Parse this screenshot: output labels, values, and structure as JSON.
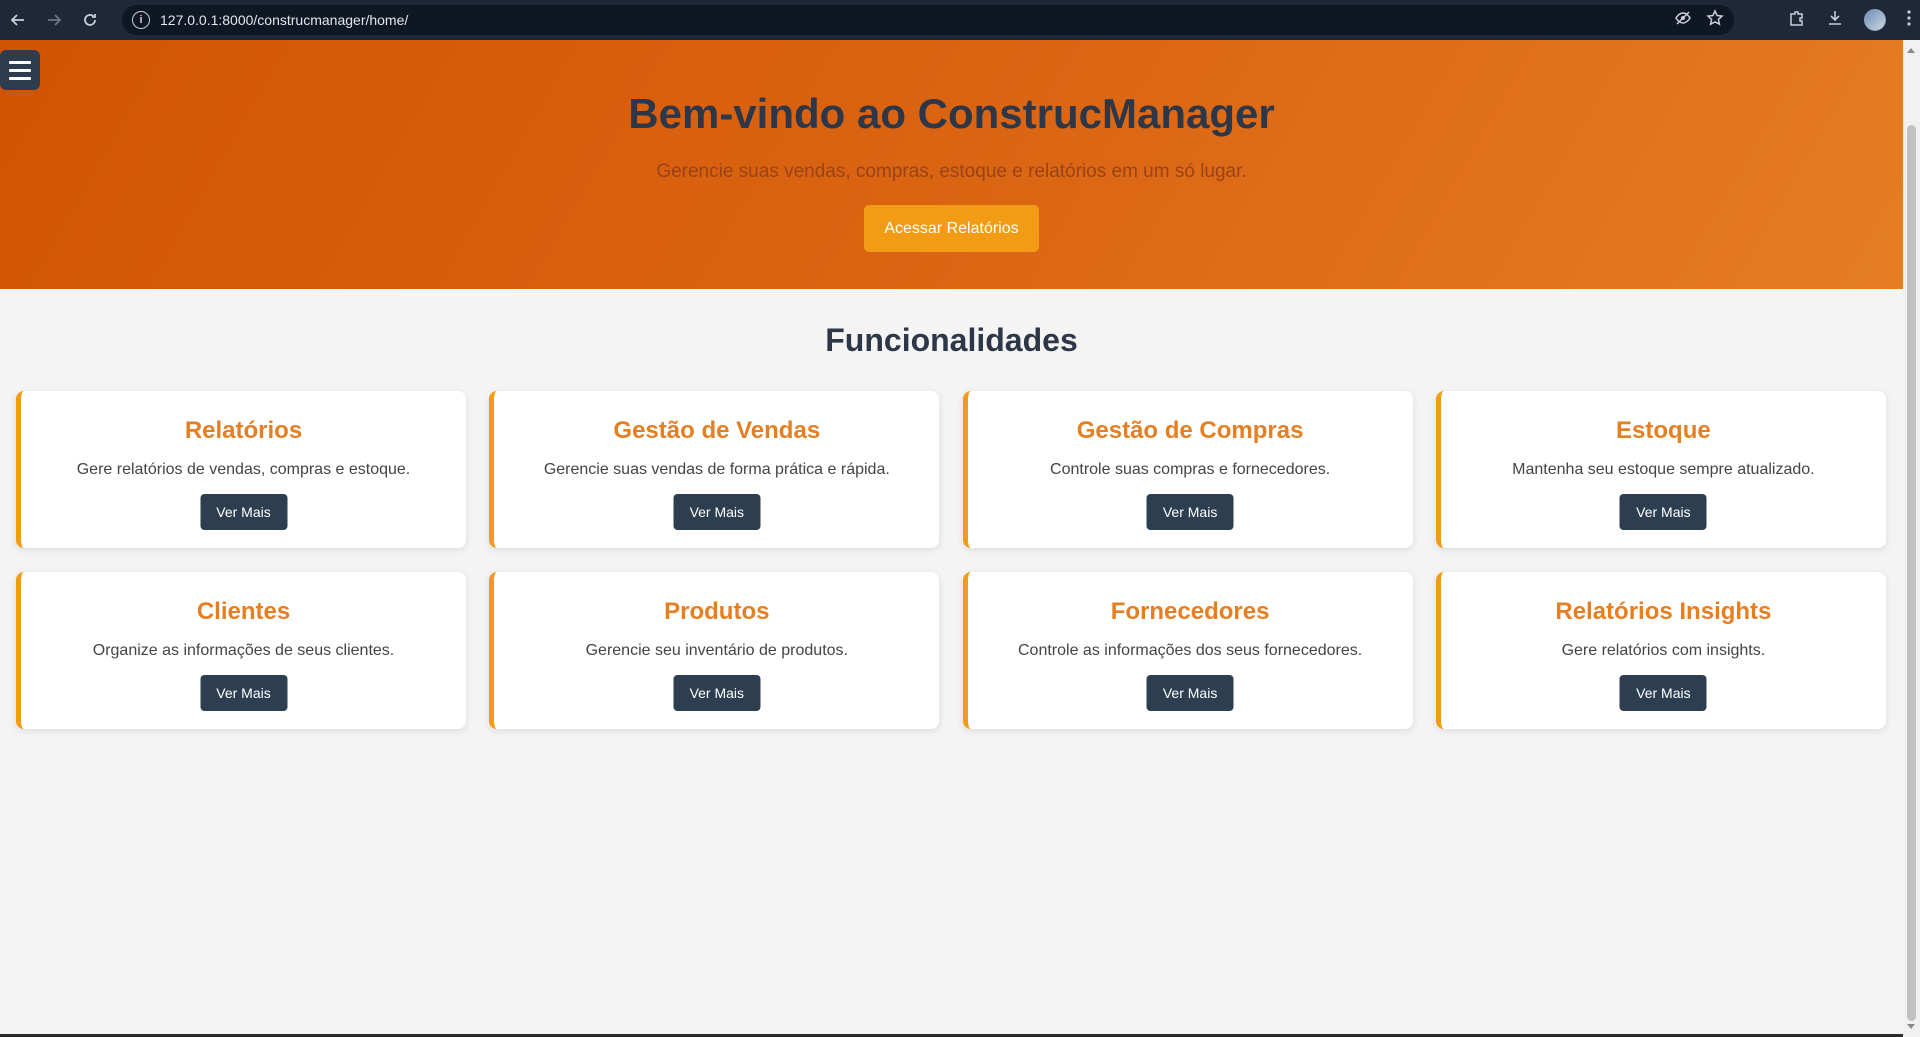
{
  "browser": {
    "url": "127.0.0.1:8000/construcmanager/home/"
  },
  "hero": {
    "title": "Bem-vindo ao ConstrucManager",
    "subtitle": "Gerencie suas vendas, compras, estoque e relatórios em um só lugar.",
    "cta_label": "Acessar Relatórios"
  },
  "features": {
    "title": "Funcionalidades",
    "button_label": "Ver Mais",
    "cards": [
      {
        "title": "Relatórios",
        "description": "Gere relatórios de vendas, compras e estoque."
      },
      {
        "title": "Gestão de Vendas",
        "description": "Gerencie suas vendas de forma prática e rápida."
      },
      {
        "title": "Gestão de Compras",
        "description": "Controle suas compras e fornecedores."
      },
      {
        "title": "Estoque",
        "description": "Mantenha seu estoque sempre atualizado."
      },
      {
        "title": "Clientes",
        "description": "Organize as informações de seus clientes."
      },
      {
        "title": "Produtos",
        "description": "Gerencie seu inventário de produtos."
      },
      {
        "title": "Fornecedores",
        "description": "Controle as informações dos seus fornecedores."
      },
      {
        "title": "Relatórios Insights",
        "description": "Gere relatórios com insights."
      }
    ]
  },
  "colors": {
    "hero_gradient_start": "#d15404",
    "hero_gradient_end": "#e57d24",
    "accent": "#f29b14",
    "card_title": "#e67e22",
    "dark_button": "#2c3e50",
    "heading": "#2d3748"
  }
}
